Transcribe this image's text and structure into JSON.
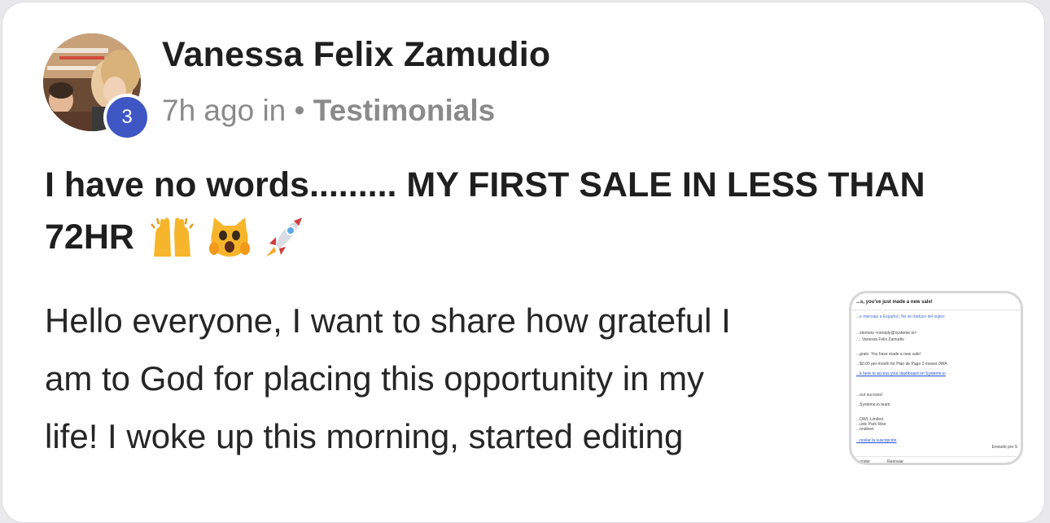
{
  "post": {
    "author": "Vanessa Felix Zamudio",
    "level": "3",
    "time": "7h ago in",
    "separator": "•",
    "category": "Testimonials",
    "title": "I have no words......... MY FIRST SALE IN LESS THAN 72HR",
    "emojis": [
      "raising-hands-icon",
      "weary-cat-icon",
      "rocket-icon"
    ],
    "body_lines": [
      "Hello everyone, I want to share how grateful I",
      "am to God for placing this opportunity in my",
      "life! I woke up this morning, started editing"
    ]
  },
  "attachment": {
    "subject": "...s, you've just made a new sale!",
    "translate_bar": "...e mensaje a Español  |  No se traduce del inglés",
    "from": "...stemeio <noreply@systeme.io>",
    "to": "...: Vanessa Felix Zamudio",
    "greeting": "...gratz. You have made a new sale!",
    "amount": "...$0.00 per month for Plan de Pago 2 meses 0WA",
    "dashboard_link": "...k here to access your dashboard on Systeme.io",
    "closing": "...our success!",
    "signature": "...Systeme.io team",
    "company": "...OWL Limited",
    "address": "...ustc Park Rise",
    "city": "...ondown",
    "unsubscribe": "...ncelar la suscripción",
    "sent_by": "Enviado por S",
    "reply_label": "...onder",
    "forward_label": "Reenviar"
  }
}
